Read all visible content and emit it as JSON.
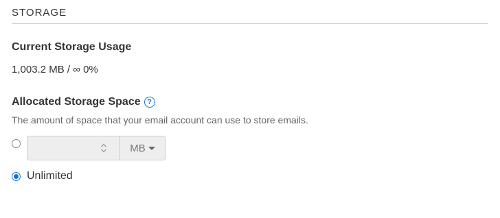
{
  "section": {
    "title": "STORAGE"
  },
  "current_usage": {
    "label": "Current Storage Usage",
    "value": "1,003.2 MB / ∞ 0%"
  },
  "allocated": {
    "label": "Allocated Storage Space",
    "help_icon": "question-circle-icon",
    "description": "The amount of space that your email account can use to store emails.",
    "options": {
      "limited": {
        "selected": false,
        "input_value": "",
        "unit": "MB"
      },
      "unlimited": {
        "selected": true,
        "label": "Unlimited"
      }
    }
  },
  "colors": {
    "accent": "#1a73c7",
    "disabled_bg": "#eeeeee",
    "rule": "#cfcfcf"
  }
}
